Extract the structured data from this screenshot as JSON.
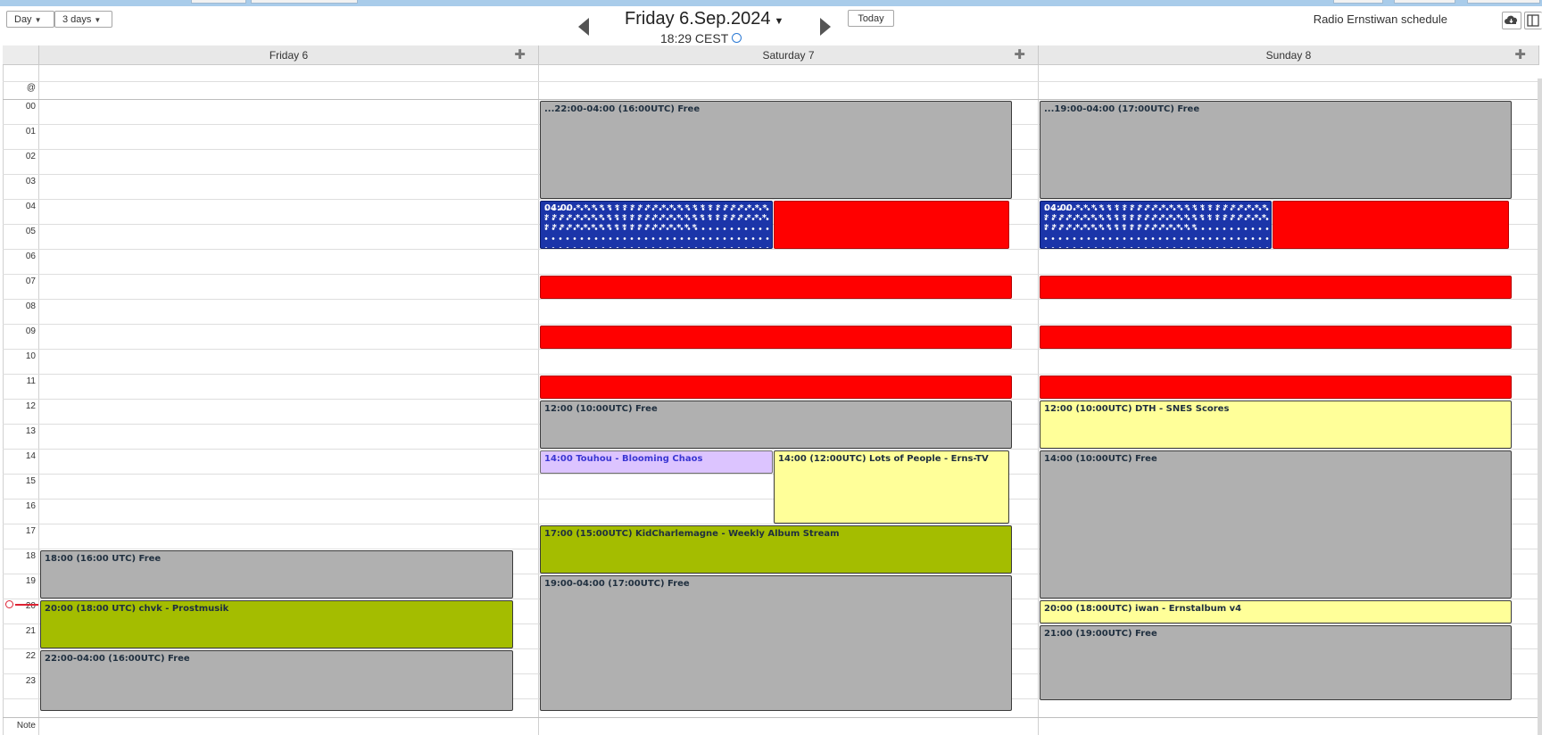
{
  "toolbar": {
    "view_day": "Day",
    "view_3days": "3 days",
    "title": "Friday 6.Sep.2024",
    "time": "18:29 CEST",
    "today": "Today",
    "schedule_name": "Radio Ernstiwan schedule"
  },
  "days": [
    {
      "label": "Friday 6"
    },
    {
      "label": "Saturday 7"
    },
    {
      "label": "Sunday 8"
    }
  ],
  "rows": {
    "allday": "@",
    "note": "Note",
    "hours": [
      "00",
      "01",
      "02",
      "03",
      "04",
      "05",
      "06",
      "07",
      "08",
      "09",
      "10",
      "11",
      "12",
      "13",
      "14",
      "15",
      "16",
      "17",
      "18",
      "19",
      "20",
      "21",
      "22",
      "23"
    ]
  },
  "events": {
    "fri": [
      {
        "text": "18:00 (16:00 UTC) Free"
      },
      {
        "text": "20:00 (18:00 UTC) chvk - Prostmusik"
      },
      {
        "text": "22:00-04:00 (16:00UTC) Free"
      }
    ],
    "sat": [
      {
        "text": "...22:00-04:00 (16:00UTC) Free"
      },
      {
        "text": "04:00 * * * * * * * * * * * * * * * * * * * * * * * * * * * * * * * * * * * * * * * * * * * * * * * * * * * * * * * * * * * * * * * * * * * * * * * * * *"
      },
      {
        "text": "12:00 (10:00UTC) Free"
      },
      {
        "text": "14:00 Touhou - Blooming Chaos"
      },
      {
        "text": "14:00 (12:00UTC) Lots of People - Erns-TV"
      },
      {
        "text": "17:00 (15:00UTC) KidCharlemagne - Weekly Album Stream"
      },
      {
        "text": "19:00-04:00 (17:00UTC) Free"
      }
    ],
    "sun": [
      {
        "text": "...19:00-04:00 (17:00UTC) Free"
      },
      {
        "text": "04:00 * * * * * * * * * * * * * * * * * * * * * * * * * * * * * * * * * * * * * * * * * * * * * * * * * * * * * * * * * * * * * * * * * * * * * * * * * *"
      },
      {
        "text": "12:00 (10:00UTC) DTH - SNES Scores"
      },
      {
        "text": "14:00 (10:00UTC) Free"
      },
      {
        "text": "20:00 (18:00UTC) iwan - Ernstalbum v4"
      },
      {
        "text": "21:00 (19:00UTC) Free"
      }
    ]
  },
  "colors": {
    "free": "#b0b0b0",
    "red": "#ff0000",
    "green": "#a4bd00",
    "yellow": "#ffff99",
    "purple": "#dcc4ff",
    "flag_blue": "#1b35a9"
  }
}
